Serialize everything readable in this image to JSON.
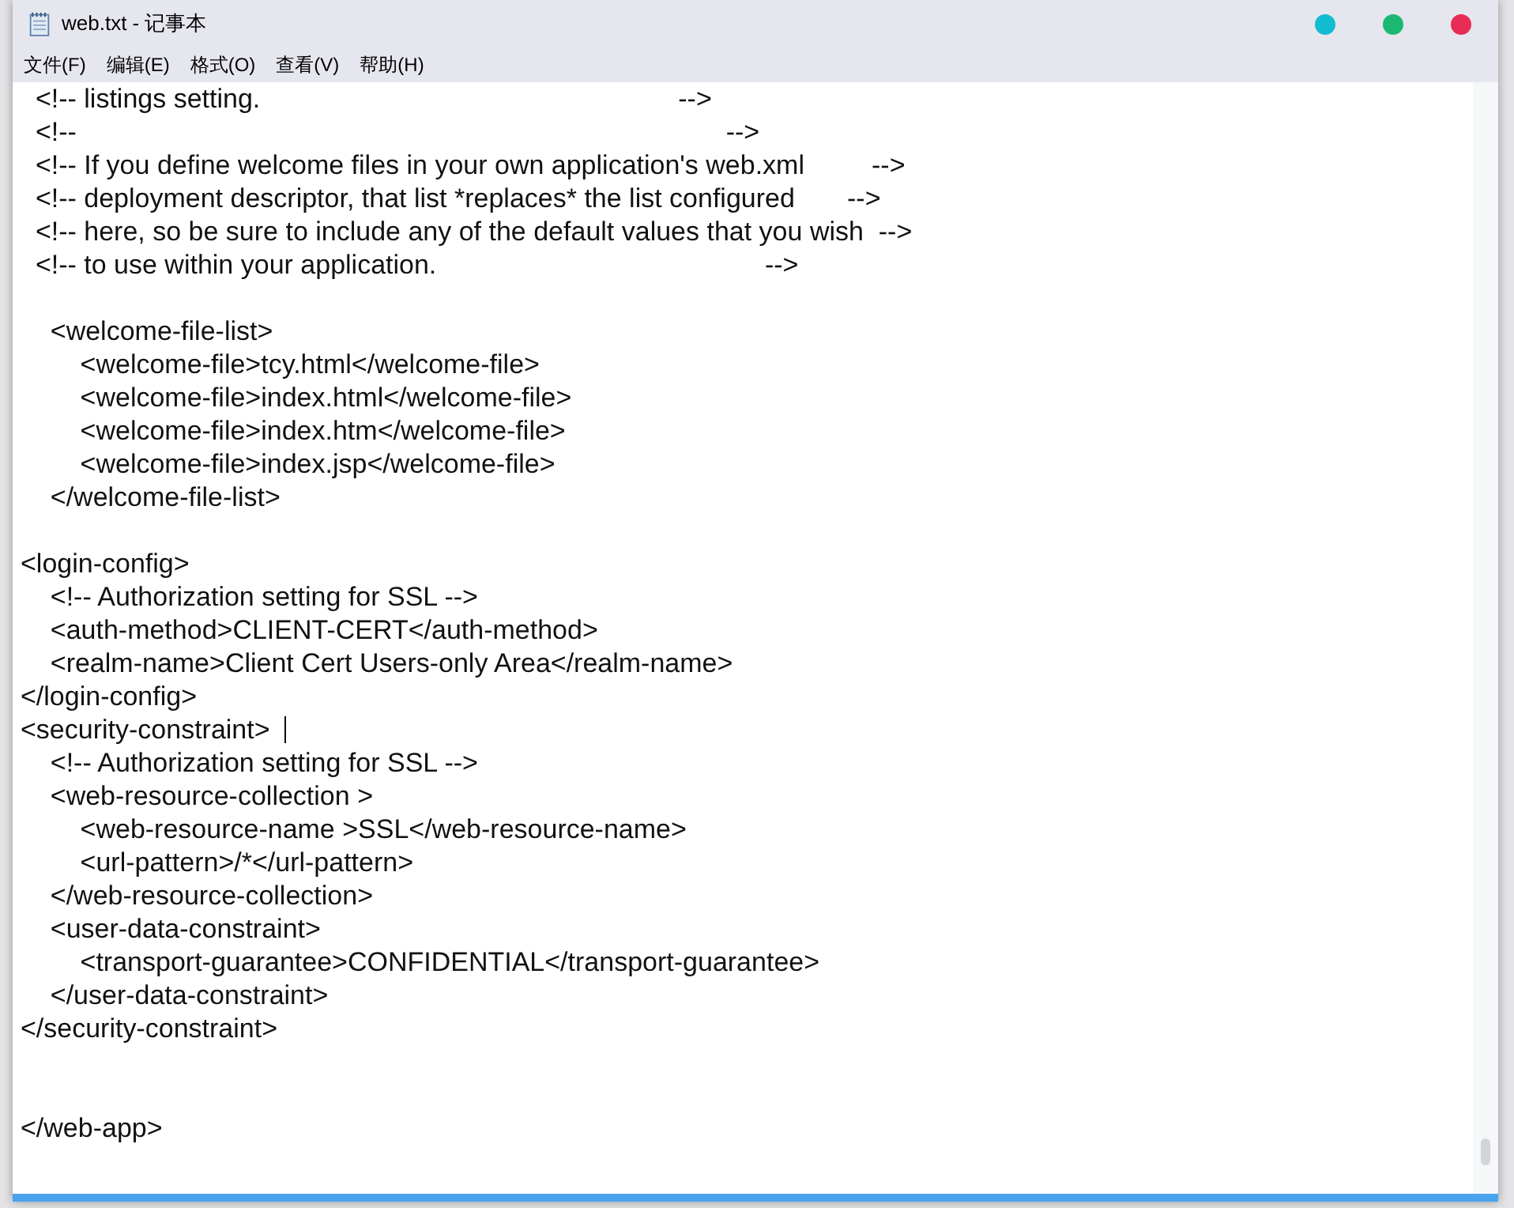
{
  "window": {
    "title": "web.txt - 记事本",
    "controls": [
      {
        "color": "#12bcd0"
      },
      {
        "color": "#1bb872"
      },
      {
        "color": "#e72c56"
      }
    ]
  },
  "menu": [
    "文件(F)",
    "编辑(E)",
    "格式(O)",
    "查看(V)",
    "帮助(H)"
  ],
  "editor": {
    "lines": [
      {
        "kind": "text",
        "text": "  <!-- listings setting.                                                        -->",
        "caret": false
      },
      {
        "kind": "text",
        "text": "  <!--                                                                                       -->",
        "caret": false
      },
      {
        "kind": "text",
        "text": "  <!-- If you define welcome files in your own application's web.xml         -->",
        "caret": false
      },
      {
        "kind": "text",
        "text": "  <!-- deployment descriptor, that list *replaces* the list configured       -->",
        "caret": false
      },
      {
        "kind": "text",
        "text": "  <!-- here, so be sure to include any of the default values that you wish  -->",
        "caret": false
      },
      {
        "kind": "text",
        "text": "  <!-- to use within your application.                                            -->",
        "caret": false
      },
      {
        "kind": "blank"
      },
      {
        "kind": "text",
        "text": "    <welcome-file-list>",
        "caret": false
      },
      {
        "kind": "text",
        "text": "        <welcome-file>tcy.html</welcome-file>",
        "caret": false
      },
      {
        "kind": "text",
        "text": "        <welcome-file>index.html</welcome-file>",
        "caret": false
      },
      {
        "kind": "text",
        "text": "        <welcome-file>index.htm</welcome-file>",
        "caret": false
      },
      {
        "kind": "text",
        "text": "        <welcome-file>index.jsp</welcome-file>",
        "caret": false
      },
      {
        "kind": "text",
        "text": "    </welcome-file-list>",
        "caret": false
      },
      {
        "kind": "blank"
      },
      {
        "kind": "text",
        "text": "<login-config>",
        "caret": false
      },
      {
        "kind": "text",
        "text": "    <!-- Authorization setting for SSL -->",
        "caret": false
      },
      {
        "kind": "text",
        "text": "    <auth-method>CLIENT-CERT</auth-method>",
        "caret": false
      },
      {
        "kind": "text",
        "text": "    <realm-name>Client Cert Users-only Area</realm-name>",
        "caret": false
      },
      {
        "kind": "text",
        "text": "</login-config>",
        "caret": false
      },
      {
        "kind": "text",
        "text": "<security-constraint> ",
        "caret": true
      },
      {
        "kind": "text",
        "text": "    <!-- Authorization setting for SSL -->",
        "caret": false
      },
      {
        "kind": "text",
        "text": "    <web-resource-collection >",
        "caret": false
      },
      {
        "kind": "text",
        "text": "        <web-resource-name >SSL</web-resource-name>",
        "caret": false
      },
      {
        "kind": "text",
        "text": "        <url-pattern>/*</url-pattern>",
        "caret": false
      },
      {
        "kind": "text",
        "text": "    </web-resource-collection>",
        "caret": false
      },
      {
        "kind": "text",
        "text": "    <user-data-constraint>",
        "caret": false
      },
      {
        "kind": "text",
        "text": "        <transport-guarantee>CONFIDENTIAL</transport-guarantee>",
        "caret": false
      },
      {
        "kind": "text",
        "text": "    </user-data-constraint>",
        "caret": false
      },
      {
        "kind": "text",
        "text": "</security-constraint>",
        "caret": false
      },
      {
        "kind": "blank"
      },
      {
        "kind": "blank"
      },
      {
        "kind": "text",
        "text": "</web-app>",
        "caret": false
      }
    ]
  }
}
